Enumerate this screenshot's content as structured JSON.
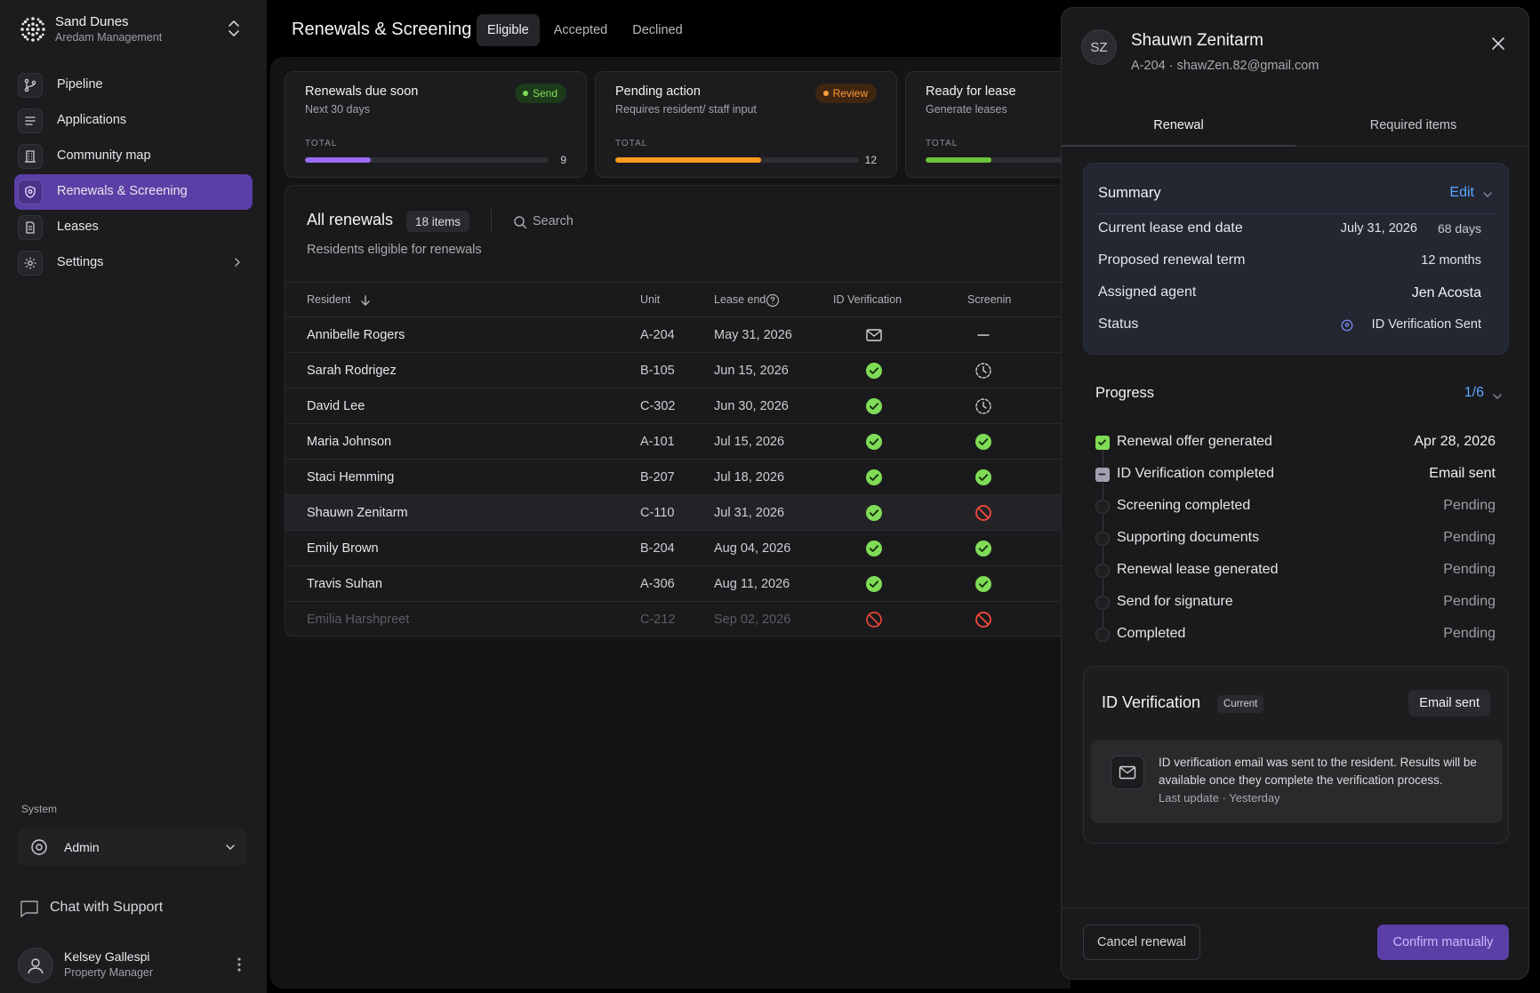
{
  "brand": {
    "name": "Sand Dunes",
    "subtitle": "Aredam Management"
  },
  "sidebar": {
    "items": [
      {
        "label": "Pipeline",
        "icon": "pipeline-icon"
      },
      {
        "label": "Applications",
        "icon": "list-icon"
      },
      {
        "label": "Community map",
        "icon": "building-icon"
      },
      {
        "label": "Renewals & Screening",
        "icon": "shield-icon",
        "active": true
      },
      {
        "label": "Leases",
        "icon": "document-icon"
      },
      {
        "label": "Settings",
        "icon": "gear-icon"
      }
    ],
    "system_label": "System",
    "admin_label": "Admin",
    "chat_label": "Chat with Support",
    "user": {
      "name": "Kelsey Gallespi",
      "role": "Property Manager"
    }
  },
  "header": {
    "title": "Renewals & Screening",
    "tabs": [
      "Eligible",
      "Accepted",
      "Declined"
    ],
    "active_tab": "Eligible"
  },
  "stats": [
    {
      "title": "Renewals due soon",
      "subtitle": "Next 30 days",
      "badge": "Send",
      "badge_color": "#7fdc57",
      "total_label": "TOTAL",
      "count": "9",
      "progress": 0.27,
      "bar_color": "#9a6cf0"
    },
    {
      "title": "Pending action",
      "subtitle": "Requires resident/ staff input",
      "badge": "Review",
      "badge_color": "#ff9b3b",
      "total_label": "TOTAL",
      "count": "12",
      "progress": 0.6,
      "bar_color": "#ff9b1f"
    },
    {
      "title": "Ready for lease",
      "subtitle": "Generate leases",
      "total_label": "TOTAL",
      "progress": 0.27,
      "bar_color": "#6cc33c"
    }
  ],
  "list": {
    "title": "All renewals",
    "count": "18 items",
    "search_placeholder": "Search",
    "subtitle": "Residents eligible for renewals",
    "columns": [
      "Resident",
      "Unit",
      "Lease end",
      "ID Verification",
      "Screenin"
    ],
    "rows": [
      {
        "name": "Annibelle Rogers",
        "unit": "A-204",
        "lease_end": "May 31, 2026",
        "id": "mail",
        "screening": "dash"
      },
      {
        "name": "Sarah Rodrigez",
        "unit": "B-105",
        "lease_end": "Jun 15, 2026",
        "id": "check",
        "screening": "clock"
      },
      {
        "name": "David Lee",
        "unit": "C-302",
        "lease_end": "Jun 30, 2026",
        "id": "check",
        "screening": "clock"
      },
      {
        "name": "Maria Johnson",
        "unit": "A-101",
        "lease_end": "Jul 15, 2026",
        "id": "check",
        "screening": "check"
      },
      {
        "name": "Staci Hemming",
        "unit": "B-207",
        "lease_end": "Jul 18, 2026",
        "id": "check",
        "screening": "check"
      },
      {
        "name": "Shauwn Zenitarm",
        "unit": "C-110",
        "lease_end": "Jul 31, 2026",
        "id": "check",
        "screening": "blocked",
        "selected": true
      },
      {
        "name": "Emily Brown",
        "unit": "B-204",
        "lease_end": "Aug 04, 2026",
        "id": "check",
        "screening": "check"
      },
      {
        "name": "Travis Suhan",
        "unit": "A-306",
        "lease_end": "Aug 11, 2026",
        "id": "check",
        "screening": "check"
      },
      {
        "name": "Emilia Harshpreet",
        "unit": "C-212",
        "lease_end": "Sep 02, 2026",
        "id": "blocked",
        "screening": "blocked",
        "dimmed": true
      }
    ]
  },
  "drawer": {
    "initials": "SZ",
    "name": "Shauwn Zenitarm",
    "meta": "A-204 · shawZen.82@gmail.com",
    "tabs": [
      "Renewal",
      "Required items"
    ],
    "summary": {
      "title": "Summary",
      "edit": "Edit",
      "rows": [
        {
          "label": "Current lease end date",
          "value": "July 31, 2026",
          "extra": "68 days"
        },
        {
          "label": "Proposed renewal term",
          "value": "12 months"
        },
        {
          "label": "Assigned agent",
          "value": "Jen Acosta"
        },
        {
          "label": "Status",
          "value": "ID Verification Sent"
        }
      ]
    },
    "progress": {
      "title": "Progress",
      "count": "1/6",
      "steps": [
        {
          "label": "Renewal offer generated",
          "value": "Apr 28, 2026",
          "state": "done"
        },
        {
          "label": "ID Verification completed",
          "value": "Email sent",
          "state": "current"
        },
        {
          "label": "Screening completed",
          "value": "Pending",
          "state": "pending"
        },
        {
          "label": "Supporting documents",
          "value": "Pending",
          "state": "pending"
        },
        {
          "label": "Renewal lease generated",
          "value": "Pending",
          "state": "pending"
        },
        {
          "label": "Send for signature",
          "value": "Pending",
          "state": "pending"
        },
        {
          "label": "Completed",
          "value": "Pending",
          "state": "pending"
        }
      ]
    },
    "id_verification": {
      "title": "ID Verification",
      "tag": "Current",
      "status": "Email sent",
      "message": "ID verification email was sent to the resident. Results will be available once they complete the verification process.",
      "last_update": "Last update · Yesterday"
    },
    "cancel_label": "Cancel renewal",
    "confirm_label": "Confirm manually"
  }
}
